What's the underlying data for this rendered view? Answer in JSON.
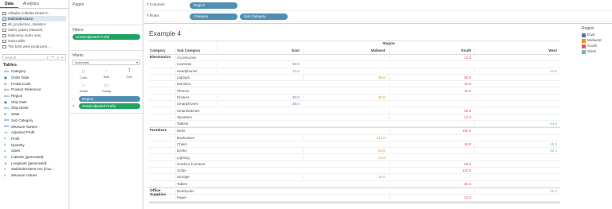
{
  "data_pane": {
    "tabs": [
      "Data",
      "Analytics"
    ],
    "sources": [
      "Alibaba (Alibaba Retail S...",
      "MultiSalesStore",
      "all_production_statistics",
      "Sales (Sales Dataset)",
      "stationery index new",
      "Swiss Bills",
      "The best wine producers..."
    ],
    "search_placeholder": "Search",
    "search_tools": "⌕ ▽ ≡ ▾",
    "tables_heading": "Tables",
    "fields": [
      {
        "type": "Abc",
        "name": "Category",
        "kind": "dim"
      },
      {
        "type": "▣",
        "name": "Order Date",
        "kind": "dim"
      },
      {
        "type": "⊕",
        "name": "Postal Code",
        "kind": "dim"
      },
      {
        "type": "Abc",
        "name": "Product Reference",
        "kind": "dim"
      },
      {
        "type": "Abc",
        "name": "Region",
        "kind": "dim"
      },
      {
        "type": "▣",
        "name": "Ship Date",
        "kind": "dim"
      },
      {
        "type": "Abc",
        "name": "Ship Mode",
        "kind": "dim"
      },
      {
        "type": "⊕",
        "name": "State",
        "kind": "dim"
      },
      {
        "type": "Abc",
        "name": "Sub Category",
        "kind": "dim"
      },
      {
        "type": "Abc",
        "name": "Measure Names",
        "kind": "dim-it"
      },
      {
        "type": "=#",
        "name": "Adjusted Profit",
        "kind": "meas"
      },
      {
        "type": "#",
        "name": "Profit",
        "kind": "meas"
      },
      {
        "type": "#",
        "name": "Quantity",
        "kind": "meas"
      },
      {
        "type": "#",
        "name": "Sales",
        "kind": "meas"
      },
      {
        "type": "⊕",
        "name": "Latitude (generated)",
        "kind": "meas-it"
      },
      {
        "type": "⊕",
        "name": "Longitude (generated)",
        "kind": "meas-it"
      },
      {
        "type": "#",
        "name": "MultiSalesStore.csv (Cou...",
        "kind": "meas-it"
      },
      {
        "type": "#",
        "name": "Measure Values",
        "kind": "meas-it"
      }
    ]
  },
  "cards": {
    "pages_label": "Pages",
    "filters_label": "Filters",
    "filter_pill": "SUM(Adjusted Profit)",
    "marks_label": "Marks",
    "mark_type": "Automatic",
    "mark_buttons": [
      {
        "glyph": "∷",
        "label": "Color"
      },
      {
        "glyph": "◌",
        "label": "Size"
      },
      {
        "glyph": "T",
        "label": "Text"
      },
      {
        "glyph": "∴",
        "label": "Detail"
      },
      {
        "glyph": "▭",
        "label": "Tooltip"
      }
    ],
    "marks_fields": [
      {
        "icon": "∷",
        "label": "Region",
        "color": "blue"
      },
      {
        "icon": "T",
        "label": "SUM(Adjusted Profit)",
        "color": "green"
      }
    ]
  },
  "shelves": {
    "columns_label": "Columns",
    "columns_pills": [
      "Region"
    ],
    "rows_label": "Rows",
    "rows_pills": [
      "Category",
      "Sub Category"
    ]
  },
  "view": {
    "title": "Example 4",
    "region_header": "Region",
    "category_header": "Category",
    "subcategory_header": "Sub Category",
    "regions": [
      "East",
      "Midwest",
      "South",
      "West"
    ],
    "groups": [
      {
        "category": "Electronics",
        "rows": [
          {
            "sub": "Accessories",
            "values": [
              "",
              "",
              "12.0",
              ""
            ]
          },
          {
            "sub": "Cameras",
            "values": [
              "60.0",
              "",
              "",
              ""
            ]
          },
          {
            "sub": "Headphones",
            "values": [
              "14.4",
              "",
              "",
              "21.6"
            ]
          },
          {
            "sub": "Laptops",
            "values": [
              "",
              "96.0",
              "68.0",
              ""
            ]
          },
          {
            "sub": "Monitors",
            "values": [
              "",
              "",
              "40.0",
              ""
            ]
          },
          {
            "sub": "Phones",
            "values": [
              "",
              "",
              "40.0",
              ""
            ]
          },
          {
            "sub": "Printers",
            "values": [
              "30.0",
              "60.0",
              "",
              ""
            ]
          },
          {
            "sub": "Smartphones",
            "values": [
              "36.0",
              "",
              "",
              ""
            ]
          },
          {
            "sub": "Smartwatches",
            "values": [
              "",
              "",
              "28.0",
              ""
            ]
          },
          {
            "sub": "Speakers",
            "values": [
              "",
              "",
              "12.0",
              ""
            ]
          },
          {
            "sub": "Tablets",
            "values": [
              "",
              "",
              "",
              "54.0"
            ]
          }
        ]
      },
      {
        "category": "Furniture",
        "rows": [
          {
            "sub": "Beds",
            "values": [
              "",
              "",
              "156.0",
              ""
            ]
          },
          {
            "sub": "Bookcases",
            "values": [
              "",
              "124.0",
              "",
              ""
            ]
          },
          {
            "sub": "Chairs",
            "values": [
              "",
              "",
              "48.0",
              "45.2"
            ]
          },
          {
            "sub": "Desks",
            "values": [
              "",
              "54.0",
              "",
              "60.4"
            ]
          },
          {
            "sub": "Lighting",
            "values": [
              "",
              "21.6",
              "",
              ""
            ]
          },
          {
            "sub": "Outdoor Furniture",
            "values": [
              "",
              "",
              "66.0",
              ""
            ]
          },
          {
            "sub": "Sofas",
            "values": [
              "",
              "",
              "120.0",
              ""
            ]
          },
          {
            "sub": "Storage",
            "values": [
              "",
              "36.0",
              "",
              ""
            ]
          },
          {
            "sub": "Tables",
            "values": [
              "",
              "",
              "86.4",
              ""
            ]
          }
        ]
      },
      {
        "category": "Office Supplies",
        "rows": [
          {
            "sub": "Notebooks",
            "values": [
              "",
              "",
              "",
              "22.4"
            ]
          },
          {
            "sub": "Paper",
            "values": [
              "",
              "",
              "12.0",
              ""
            ]
          }
        ]
      }
    ]
  },
  "legend": {
    "title": "Region",
    "items": [
      {
        "label": "East",
        "color": "#4e79a7"
      },
      {
        "label": "Midwest",
        "color": "#f28e2b"
      },
      {
        "label": "South",
        "color": "#e15759"
      },
      {
        "label": "West",
        "color": "#76b7b2"
      }
    ]
  }
}
